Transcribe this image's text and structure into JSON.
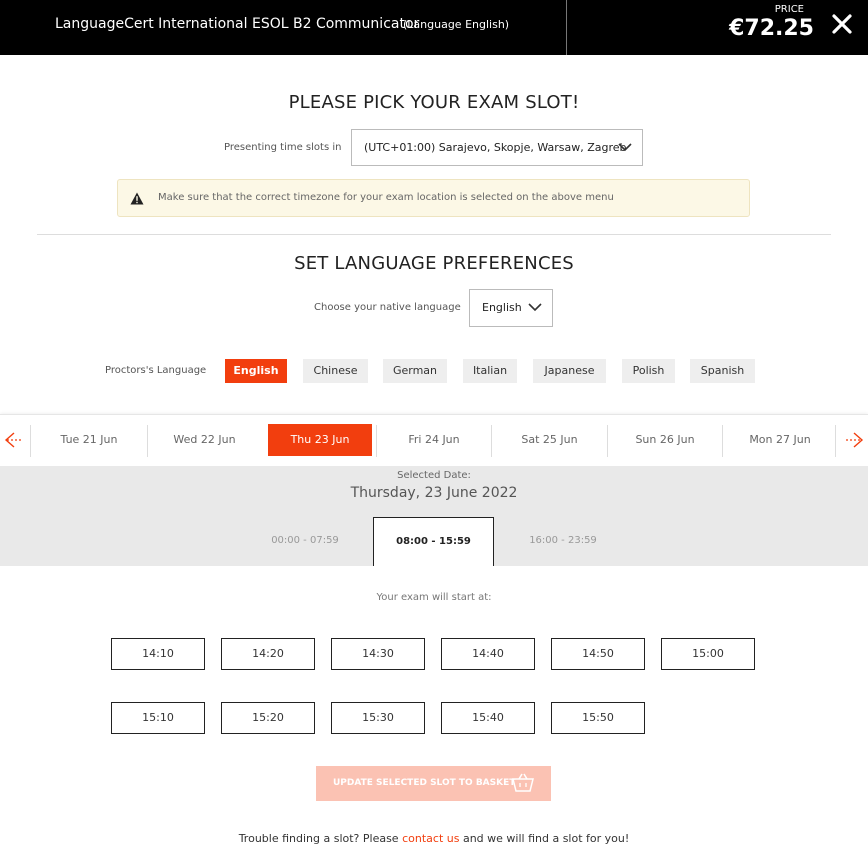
{
  "header": {
    "title": "LanguageCert International ESOL B2 Communicator",
    "language": "(Language English)",
    "price_label": "PRICE",
    "price_value": "€72.25",
    "close_icon": "close-icon"
  },
  "slot_section": {
    "title": "PLEASE PICK YOUR EXAM SLOT!",
    "timezone_label": "Presenting time slots in",
    "timezone_value": "(UTC+01:00) Sarajevo, Skopje, Warsaw, Zagreb",
    "warning_icon": "warning-icon",
    "warning_text": "Make sure that the correct timezone for your exam location is selected on the above menu"
  },
  "language_section": {
    "title": "SET LANGUAGE PREFERENCES",
    "native_label": "Choose your native language",
    "native_value": "English",
    "proctor_label": "Proctors's Language",
    "proctor_languages": [
      "English",
      "Chinese",
      "German",
      "Italian",
      "Japanese",
      "Polish",
      "Spanish"
    ],
    "proctor_selected": "English"
  },
  "dates": {
    "prev_icon": "arrow-left-icon",
    "next_icon": "arrow-right-icon",
    "days": [
      "Tue 21 Jun",
      "Wed 22 Jun",
      "Thu 23 Jun",
      "Fri 24 Jun",
      "Sat 25 Jun",
      "Sun 26 Jun",
      "Mon 27 Jun"
    ],
    "selected_day": "Thu 23 Jun"
  },
  "selected": {
    "label": "Selected Date:",
    "date": "Thursday, 23 June 2022",
    "ranges": [
      "00:00 - 07:59",
      "08:00 - 15:59",
      "16:00 - 23:59"
    ],
    "selected_range": "08:00 - 15:59"
  },
  "times": {
    "label": "Your exam will start at:",
    "slots": [
      "14:10",
      "14:20",
      "14:30",
      "14:40",
      "14:50",
      "15:00",
      "15:10",
      "15:20",
      "15:30",
      "15:40",
      "15:50"
    ]
  },
  "basket": {
    "label": "UPDATE SELECTED SLOT TO BASKET",
    "icon": "basket-icon"
  },
  "footer": {
    "before": "Trouble finding a slot? Please",
    "link": "contact us",
    "after": "and we will find a slot for you!"
  },
  "colors": {
    "accent": "#f23e0e",
    "header_bg": "#000000",
    "basket_disabled": "#fbc2b3",
    "panel_grey": "#e9e9e9"
  }
}
